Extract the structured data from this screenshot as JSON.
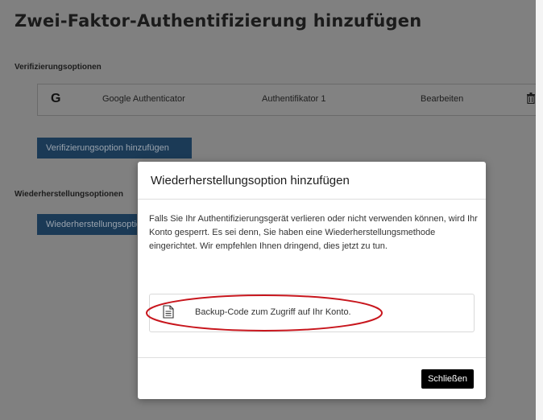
{
  "page": {
    "title": "Zwei-Faktor-Authentifizierung hinzufügen",
    "verification_label": "Verifizierungsoptionen",
    "recovery_label": "Wiederherstellungsoptionen"
  },
  "method": {
    "icon": "google-g-icon",
    "glyph": "G",
    "name": "Google Authenticator",
    "label": "Authentifikator 1",
    "edit_label": "Bearbeiten",
    "delete_icon": "trash-icon"
  },
  "buttons": {
    "add_verification": "Verifizierungsoption hinzufügen",
    "add_recovery": "Wiederherstellungsoption hinzufügen"
  },
  "modal": {
    "title": "Wiederherstellungsoption hinzufügen",
    "body": "Falls Sie Ihr Authentifizierungsgerät verlieren oder nicht verwenden können, wird Ihr Konto gesperrt. Es sei denn, Sie haben eine Wiederherstellungsmethode eingerichtet. Wir empfehlen Ihnen dringend, dies jetzt zu tun.",
    "option_icon": "document-icon",
    "option_label": "Backup-Code zum Zugriff auf Ihr Konto.",
    "close_label": "Schließen"
  },
  "colors": {
    "overlay": "#808080",
    "primary_button": "#1b3a56",
    "highlight_ellipse": "#c8161d",
    "close_button": "#000000"
  }
}
